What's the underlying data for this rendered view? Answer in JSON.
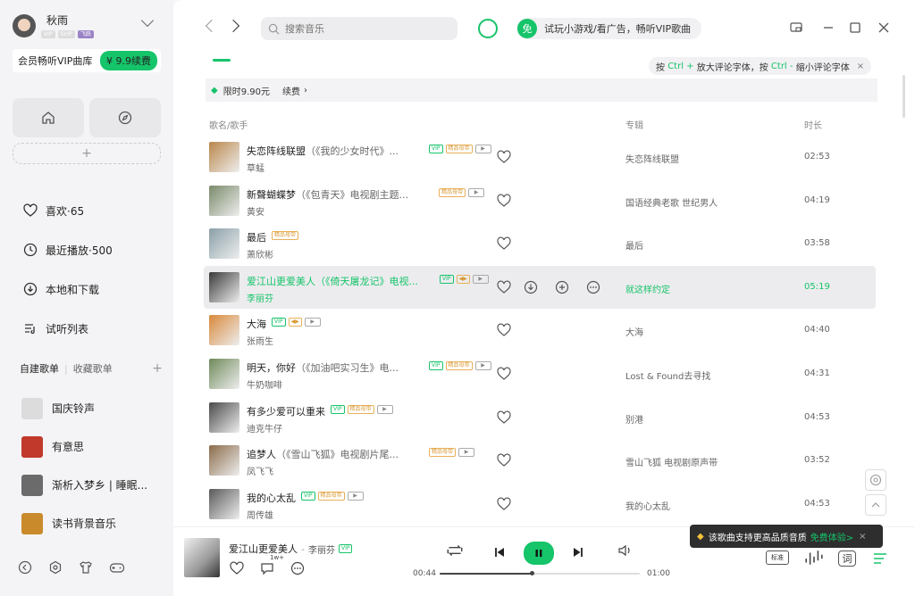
{
  "sidebar": {
    "username": "秋雨",
    "badges": [
      "VIP",
      "SVIP",
      "飞跃"
    ],
    "vip_text": "会员畅听VIP曲库",
    "renew_label": "¥ 9.9续费",
    "menu": [
      {
        "label": "喜欢·65",
        "icon": "heart-icon"
      },
      {
        "label": "最近播放·500",
        "icon": "clock-icon"
      },
      {
        "label": "本地和下载",
        "icon": "download-icon"
      },
      {
        "label": "试听列表",
        "icon": "playlist-icon"
      }
    ],
    "tab_created": "自建歌单",
    "tab_collected": "收藏歌单",
    "playlists": [
      {
        "label": "国庆铃声",
        "color": "#d9d9d9"
      },
      {
        "label": "有意思",
        "color": "#c0392b"
      },
      {
        "label": "渐析入梦乡 | 睡眠...",
        "color": "#6b6b6b"
      },
      {
        "label": "读书背景音乐",
        "color": "#c98a2c"
      }
    ]
  },
  "header": {
    "search_placeholder": "搜索音乐",
    "promo_badge": "免",
    "promo_text": "试玩小游戏/看广告，畅听VIP歌曲",
    "tip": {
      "a": "按",
      "ctrl1": "Ctrl +",
      "b": "放大评论字体，按",
      "ctrl2": "Ctrl -",
      "c": "缩小评论字体"
    },
    "limited_text": "限时9.90元",
    "renew_text": "续费",
    "renew_arrow": "›",
    "tip_close": "×"
  },
  "table": {
    "col_song": "歌名/歌手",
    "col_album": "专辑",
    "col_duration": "时长",
    "rows": [
      {
        "title": "失恋阵线联盟",
        "sub": "（《我的少女时代》...",
        "artist": "草蜢",
        "tags": [
          "VIP",
          "精品母带",
          "MV"
        ],
        "album": "失恋阵线联盟",
        "duration": "02:53",
        "color": "#b9874a"
      },
      {
        "title": "新聲蝴蝶梦",
        "sub": "（《包青天》电视剧主题...",
        "artist": "黄安",
        "tags": [
          "精品母带",
          "MV"
        ],
        "album": "国语经典老歌 世纪男人",
        "duration": "04:19",
        "color": "#7a8a6a"
      },
      {
        "title": "最后",
        "sub": "",
        "artist": "萧欣彬",
        "tags": [
          "精品母带"
        ],
        "album": "最后",
        "duration": "03:58",
        "color": "#8aa0a8"
      },
      {
        "title": "爱江山更爱美人",
        "sub": "（《倚天屠龙记》电视...",
        "artist": "李丽芬",
        "tags": [
          "VIP",
          "HQ",
          "MV"
        ],
        "album": "就这样约定",
        "duration": "05:19",
        "color": "#3a3a3a",
        "active": true
      },
      {
        "title": "大海",
        "sub": "",
        "artist": "张雨生",
        "tags": [
          "VIP",
          "HQ",
          "MV"
        ],
        "album": "大海",
        "duration": "04:40",
        "color": "#d8893a"
      },
      {
        "title": "明天，你好",
        "sub": "（《加油吧实习生》电...",
        "artist": "牛奶咖啡",
        "tags": [
          "VIP",
          "精品母带",
          "MV"
        ],
        "album": "Lost & Found去寻找",
        "duration": "04:31",
        "color": "#6f8a5a"
      },
      {
        "title": "有多少爱可以重来",
        "sub": "",
        "artist": "迪克牛仔",
        "tags": [
          "VIP",
          "精品母带",
          "MV"
        ],
        "album": "别港",
        "duration": "04:53",
        "color": "#4a4a4a"
      },
      {
        "title": "追梦人",
        "sub": "（《雪山飞狐》电视剧片尾...",
        "artist": "凤飞飞",
        "tags": [
          "精品母带",
          "MV"
        ],
        "album": "雪山飞狐 电视剧原声带",
        "duration": "03:52",
        "color": "#8b6b4a"
      },
      {
        "title": "我的心太乱",
        "sub": "",
        "artist": "周传雄",
        "tags": [
          "VIP",
          "精品母带",
          "MV"
        ],
        "album": "我的心太乱",
        "duration": "04:53",
        "color": "#5a5a5a"
      }
    ]
  },
  "player": {
    "title": "爱江山更爱美人",
    "sep": "-",
    "artist": "李丽芬",
    "tag": "VIP",
    "comments": "1w+",
    "elapsed": "00:44",
    "total": "01:00",
    "progress_fraction": 0.46,
    "quality": "标准",
    "lyrics": "词"
  },
  "toast": {
    "text": "该歌曲支持更高品质音质",
    "cta": "免费体验>",
    "close": "×"
  },
  "colors": {
    "accent": "#16c46a"
  }
}
